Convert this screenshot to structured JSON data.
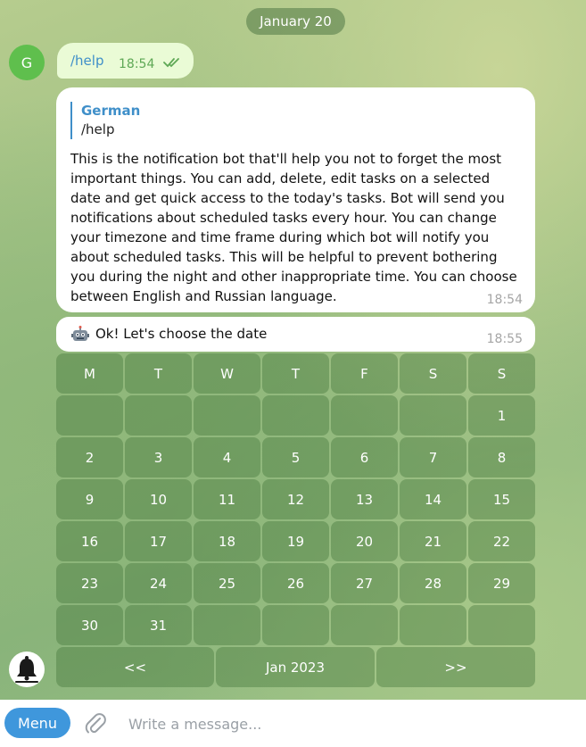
{
  "chat": {
    "date_label": "January 20",
    "user_avatar_letter": "G",
    "outgoing": {
      "text": "/help",
      "time": "18:54",
      "status_icon": "double-check-icon"
    },
    "help_message": {
      "reply_name": "German",
      "reply_text": "/help",
      "body": "This is the notification bot that'll help you not to forget the most important things. You can add, delete, edit tasks on a selected date and get quick access to the today's tasks. Bot will send you notifications about scheduled tasks every hour. You can change your timezone and time frame during which bot will notify you about scheduled tasks. This will be helpful to prevent bothering you during the night and other inappropriate time. You can choose between English and Russian language.",
      "time": "18:54"
    },
    "choose_message": {
      "icon": "robot-icon",
      "text": "Ok! Let's choose the date",
      "time": "18:55"
    },
    "bot_avatar_icon": "bell-icon"
  },
  "calendar": {
    "weekdays": [
      "M",
      "T",
      "W",
      "T",
      "F",
      "S",
      "S"
    ],
    "weeks": [
      [
        "",
        "",
        "",
        "",
        "",
        "",
        "1"
      ],
      [
        "2",
        "3",
        "4",
        "5",
        "6",
        "7",
        "8"
      ],
      [
        "9",
        "10",
        "11",
        "12",
        "13",
        "14",
        "15"
      ],
      [
        "16",
        "17",
        "18",
        "19",
        "20",
        "21",
        "22"
      ],
      [
        "23",
        "24",
        "25",
        "26",
        "27",
        "28",
        "29"
      ],
      [
        "30",
        "31",
        "",
        "",
        "",
        "",
        ""
      ]
    ],
    "nav": {
      "prev": "<<",
      "month": "Jan 2023",
      "next": ">>"
    }
  },
  "footer": {
    "menu_label": "Menu",
    "input_placeholder": "Write a message...",
    "attach_icon": "paperclip-icon"
  },
  "colors": {
    "accent": "#3f97dc",
    "link": "#3f8fc9",
    "outgoing_bubble": "#eafbd6",
    "keyboard_button": "rgba(70,120,60,0.42)"
  }
}
